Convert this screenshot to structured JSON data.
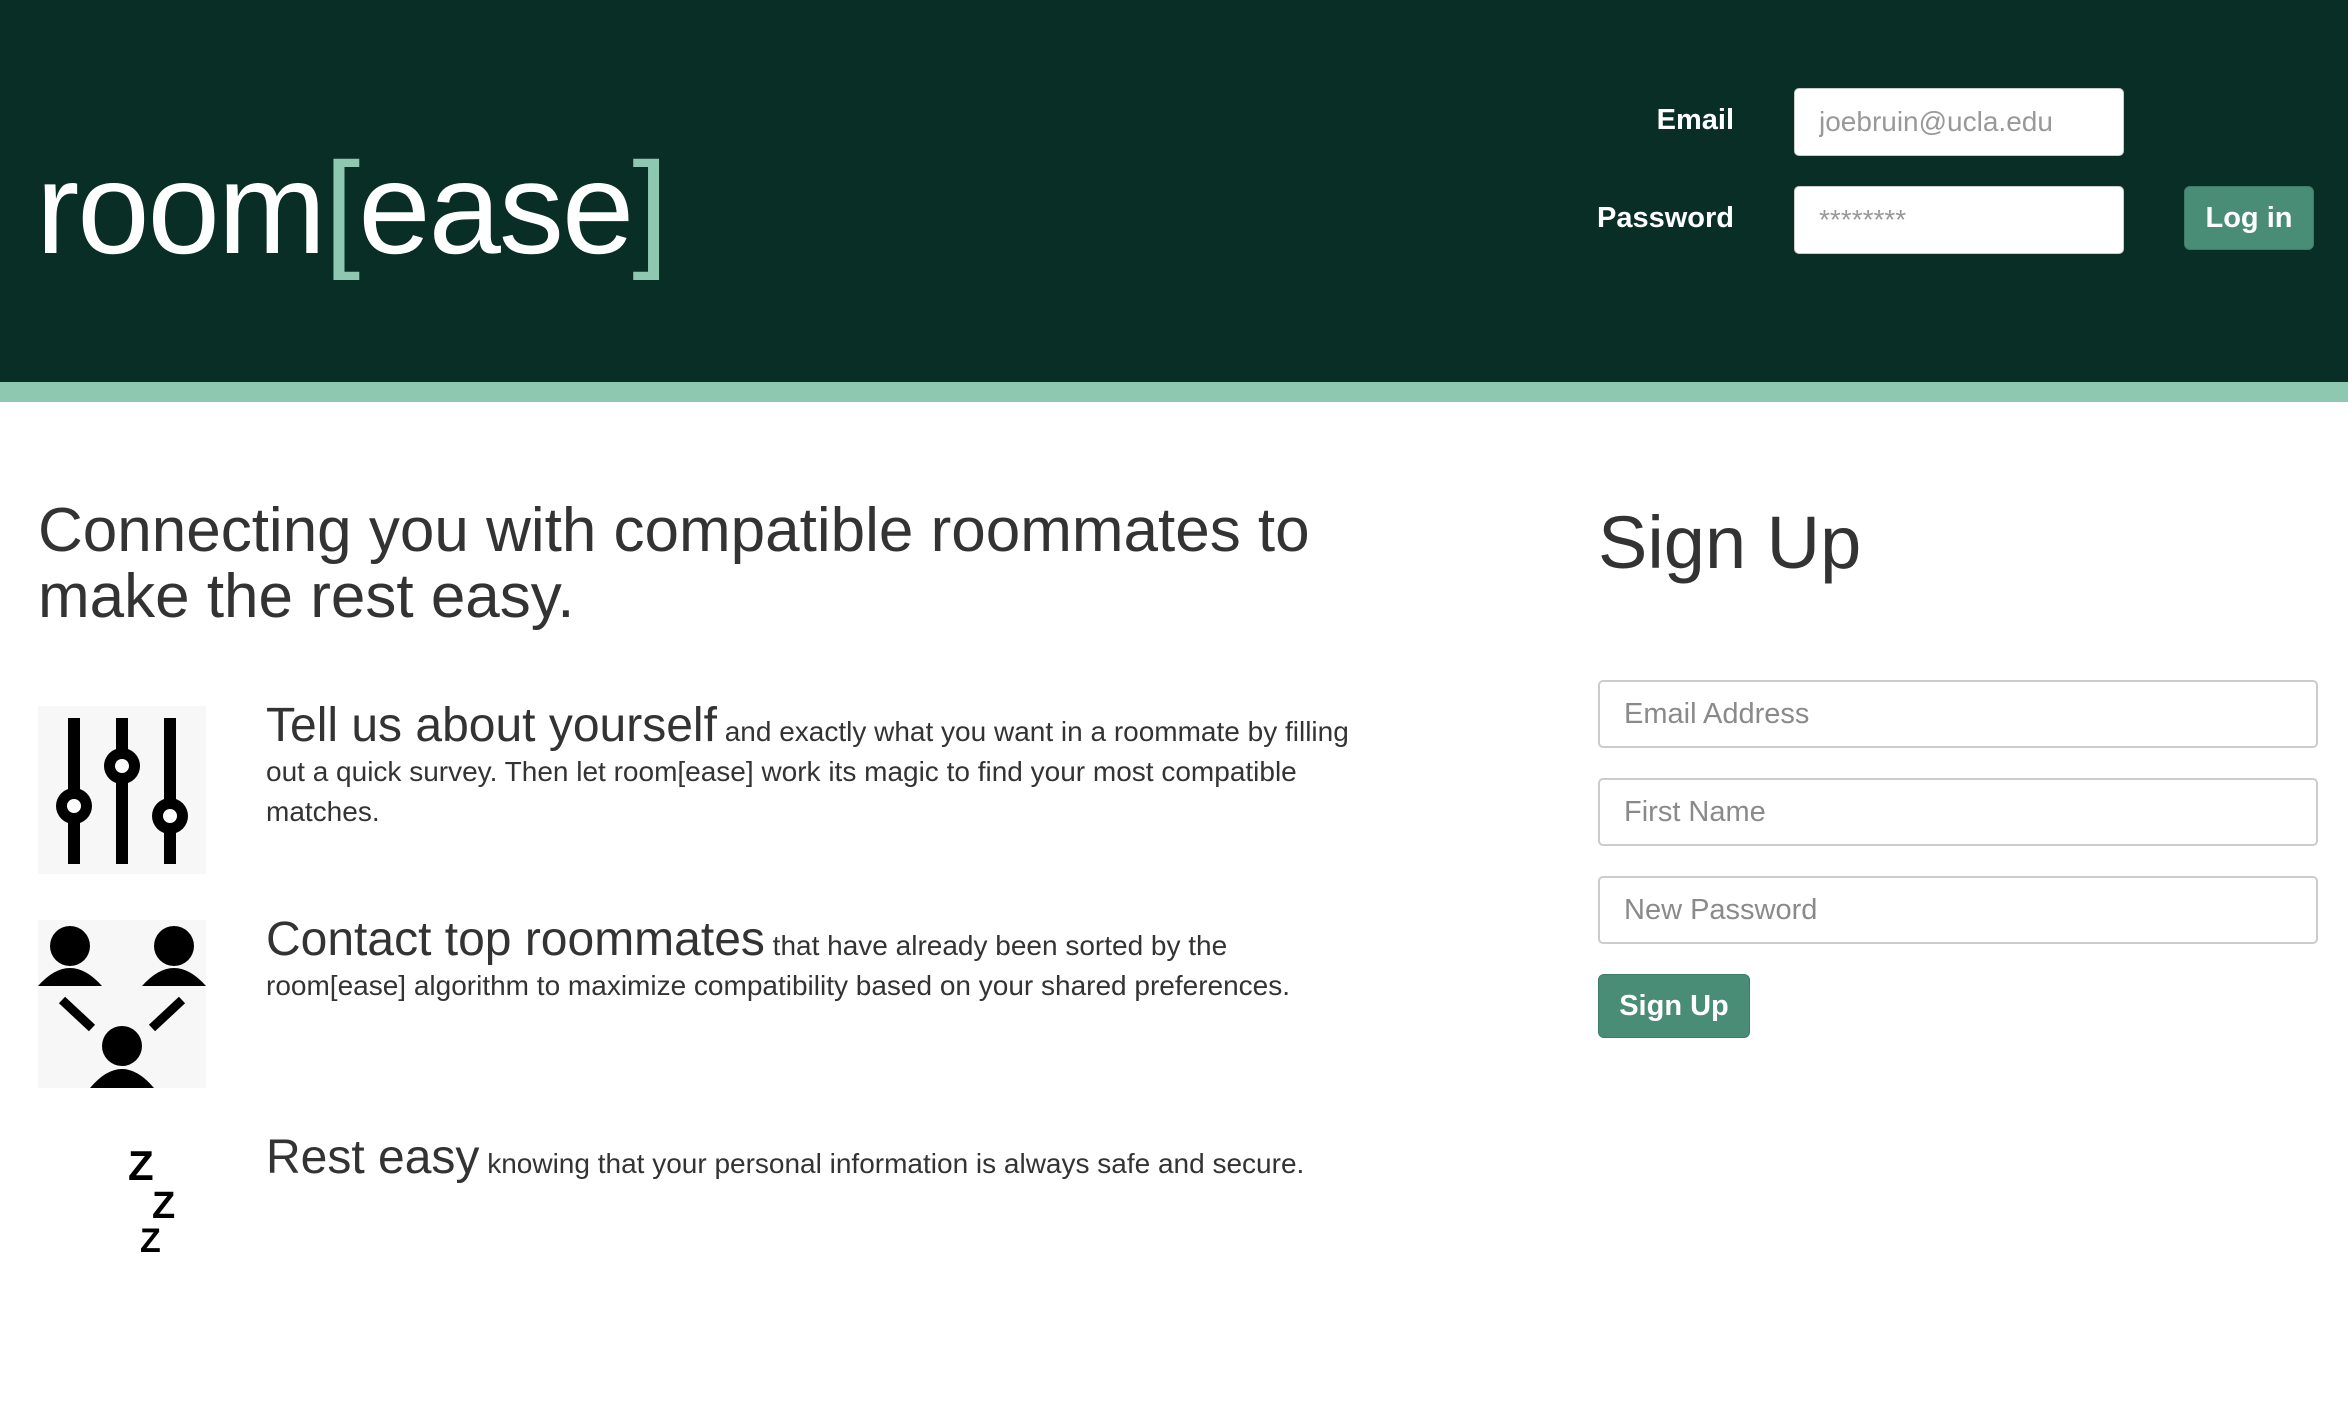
{
  "header": {
    "logo_room": "room",
    "logo_open_bracket": "[",
    "logo_ease": "ease",
    "logo_close_bracket": "]",
    "email_label": "Email",
    "email_placeholder": "joebruin@ucla.edu",
    "password_label": "Password",
    "password_placeholder": "********",
    "login_button": "Log in",
    "background_color": "#082e26",
    "accent_color": "#8ec8b0",
    "button_color": "#4a8d77"
  },
  "main": {
    "tagline": "Connecting you with compatible roommates to make the rest easy.",
    "features": [
      {
        "icon": "sliders-icon",
        "title": "Tell us about yourself",
        "text": " and exactly what you want in a roommate by filling out a quick survey. Then let room[ease] work its magic to find your most compatible matches."
      },
      {
        "icon": "people-connect-icon",
        "title": "Contact top roommates",
        "text": " that have already been sorted by the room[ease] algorithm to maximize compatibility based on your shared preferences."
      },
      {
        "icon": "moon-sleep-icon",
        "title": "Rest easy",
        "text": " knowing that your personal information is always safe and secure."
      }
    ]
  },
  "signup": {
    "title": "Sign Up",
    "email_placeholder": "Email Address",
    "first_name_placeholder": "First Name",
    "password_placeholder": "New Password",
    "button": "Sign Up"
  }
}
